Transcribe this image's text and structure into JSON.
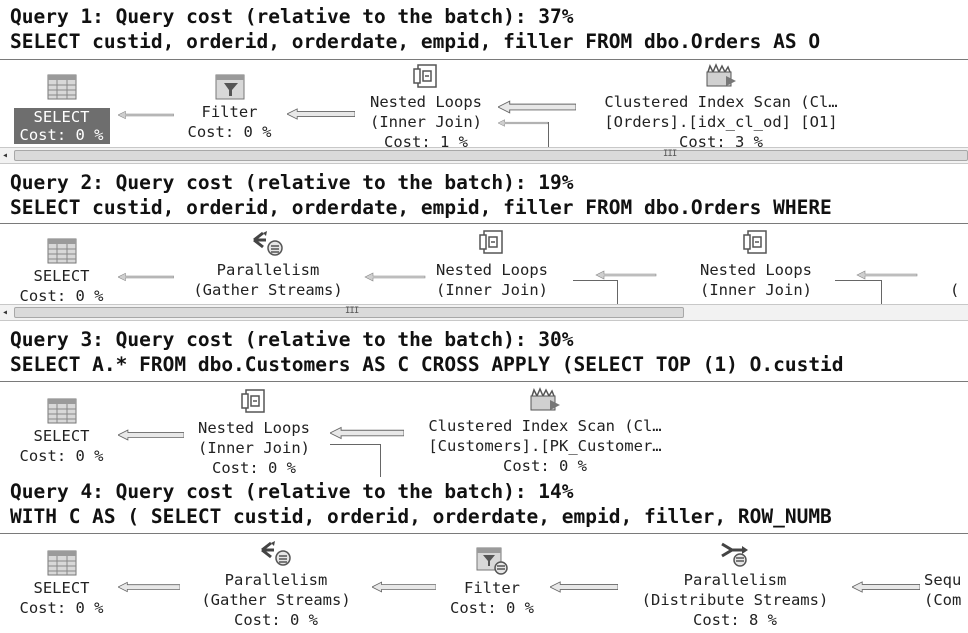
{
  "queries": [
    {
      "header": "Query 1: Query cost (relative to the batch): 37%",
      "sql": "SELECT custid, orderid, orderdate, empid, filler FROM dbo.Orders AS O",
      "nodes": [
        {
          "line1": "SELECT",
          "line2": "Cost: 0 %",
          "icon": "select-icon"
        },
        {
          "line1": "Filter",
          "line2": "Cost: 0 %",
          "icon": "filter-icon"
        },
        {
          "line1": "Nested Loops",
          "line2": "(Inner Join)",
          "line3": "Cost: 1 %",
          "icon": "nested-loops-icon"
        },
        {
          "line1": "Clustered Index Scan (Cl…",
          "line2": "[Orders].[idx_cl_od] [O1]",
          "line3": "Cost: 3 %",
          "icon": "clustered-index-scan-icon"
        }
      ],
      "scrollbar_grip": "III"
    },
    {
      "header": "Query 2: Query cost (relative to the batch): 19%",
      "sql": "SELECT custid, orderid, orderdate, empid, filler FROM dbo.Orders WHERE",
      "nodes": [
        {
          "line1": "SELECT",
          "line2": "Cost: 0 %",
          "icon": "select-icon"
        },
        {
          "line1": "Parallelism",
          "line2": "(Gather Streams)",
          "icon": "parallelism-icon"
        },
        {
          "line1": "Nested Loops",
          "line2": "(Inner Join)",
          "icon": "nested-loops-icon"
        },
        {
          "line1": "Nested Loops",
          "line2": "(Inner Join)",
          "icon": "nested-loops-icon"
        },
        {
          "line1": "(",
          "icon": ""
        }
      ],
      "scrollbar_grip": "III"
    },
    {
      "header": "Query 3: Query cost (relative to the batch): 30%",
      "sql": "SELECT A.* FROM dbo.Customers AS C CROSS APPLY (SELECT TOP (1) O.custid",
      "nodes": [
        {
          "line1": "SELECT",
          "line2": "Cost: 0 %",
          "icon": "select-icon"
        },
        {
          "line1": "Nested Loops",
          "line2": "(Inner Join)",
          "line3": "Cost: 0 %",
          "icon": "nested-loops-icon"
        },
        {
          "line1": "Clustered Index Scan (Cl…",
          "line2": "[Customers].[PK_Customer…",
          "line3": "Cost: 0 %",
          "icon": "clustered-index-scan-icon"
        }
      ]
    },
    {
      "header": "Query 4: Query cost (relative to the batch): 14%",
      "sql": "WITH C AS ( SELECT custid, orderid, orderdate, empid, filler, ROW_NUMB",
      "nodes": [
        {
          "line1": "SELECT",
          "line2": "Cost: 0 %",
          "icon": "select-icon"
        },
        {
          "line1": "Parallelism",
          "line2": "(Gather Streams)",
          "line3": "Cost: 0 %",
          "icon": "parallelism-icon"
        },
        {
          "line1": "Filter",
          "line2": "Cost: 0 %",
          "icon": "filter-icon"
        },
        {
          "line1": "Parallelism",
          "line2": "(Distribute Streams)",
          "line3": "Cost: 8 %",
          "icon": "parallelism-distribute-icon"
        },
        {
          "line1": "Sequ",
          "line2": "(Com",
          "icon": ""
        }
      ]
    }
  ]
}
